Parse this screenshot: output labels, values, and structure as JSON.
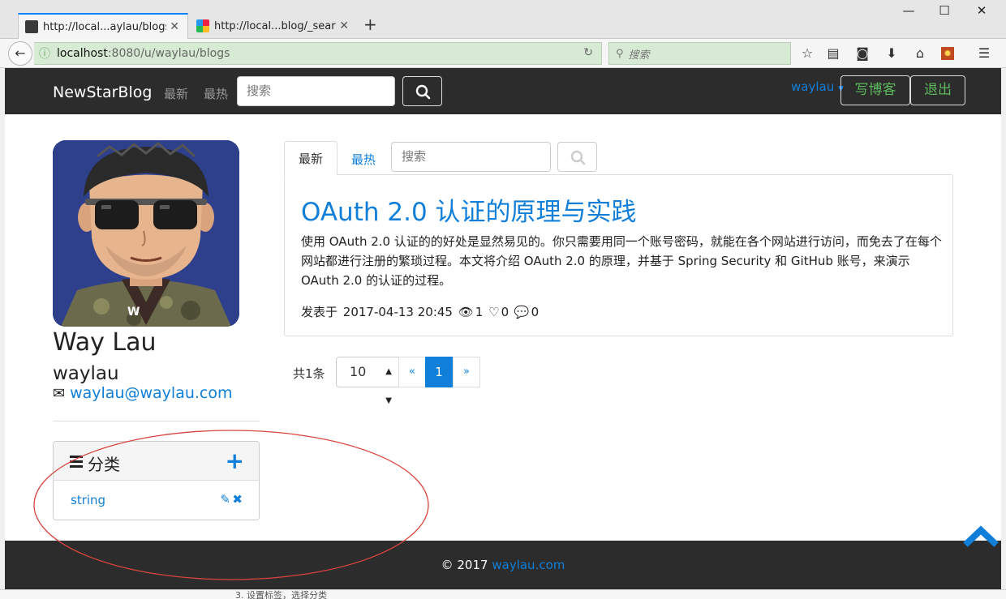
{
  "browser": {
    "tabs": [
      {
        "title": "http://local...aylau/blogs",
        "active": true
      },
      {
        "title": "http://local...blog/_search",
        "active": false
      }
    ],
    "new_tab_label": "+",
    "url_host": "localhost",
    "url_path": ":8080/u/waylau/blogs",
    "search_placeholder": "搜索"
  },
  "header": {
    "brand": "NewStarBlog",
    "links": [
      "最新",
      "最热"
    ],
    "search_placeholder": "搜索",
    "user": "waylau",
    "write_button": "写博客",
    "logout_button": "退出"
  },
  "profile": {
    "name": "Way Lau",
    "username": "waylau",
    "email": "waylau@waylau.com"
  },
  "categories": {
    "title": "分类",
    "items": [
      {
        "label": "string"
      }
    ]
  },
  "main": {
    "tab_new": "最新",
    "tab_hot": "最热",
    "search_placeholder": "搜索",
    "post": {
      "title": "OAuth 2.0 认证的原理与实践",
      "summary": "使用 OAuth 2.0 认证的的好处是显然易见的。你只需要用同一个账号密码，就能在各个网站进行访问，而免去了在每个网站都进行注册的繁琐过程。本文将介绍 OAuth 2.0 的原理，并基于 Spring Security 和 GitHub 账号，来演示 OAuth 2.0 的认证的过程。",
      "published_prefix": "发表于",
      "published": "2017-04-13 20:45",
      "views": "1",
      "likes": "0",
      "comments": "0"
    },
    "pagination": {
      "total": "共1条",
      "page_size": "10",
      "prev": "«",
      "current": "1",
      "next": "»"
    }
  },
  "footer": {
    "copyright": "© 2017",
    "link": "waylau.com"
  },
  "underlying_text": "3.  设置标签，选择分类",
  "colors": {
    "accent": "#0f7fd9",
    "success": "#5cb85c",
    "navbar": "#2c2c2c",
    "annotation": "#d9443d"
  }
}
